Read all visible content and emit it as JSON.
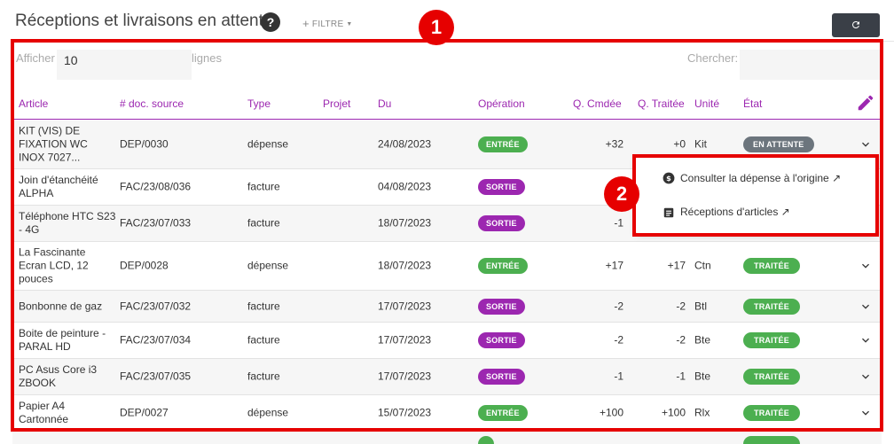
{
  "header": {
    "title": "Réceptions et livraisons en attente",
    "help": "?",
    "filter_label": "FILTRE",
    "refresh_icon": "refresh-icon"
  },
  "controls": {
    "show_label": "Afficher",
    "page_size": "10",
    "lines_label": "lignes",
    "search_label": "Chercher:"
  },
  "columns": [
    "Article",
    "# doc. source",
    "Type",
    "Projet",
    "Du",
    "Opération",
    "Q. Cmdée",
    "Q. Traitée",
    "Unité",
    "État"
  ],
  "rows": [
    {
      "article": "KIT (VIS) DE FIXATION WC INOX 7027...",
      "doc": "DEP/0030",
      "type": "dépense",
      "projet": "",
      "du": "24/08/2023",
      "operation": "ENTRÉE",
      "qcmd": "+32",
      "qtraitee": "+0",
      "unite": "Kit",
      "etat": "EN ATTENTE"
    },
    {
      "article": "Join d'étanchéité ALPHA",
      "doc": "FAC/23/08/036",
      "type": "facture",
      "projet": "",
      "du": "04/08/2023",
      "operation": "SORTIE",
      "qcmd": "",
      "qtraitee": "",
      "unite": "",
      "etat": ""
    },
    {
      "article": "Téléphone HTC S23 - 4G",
      "doc": "FAC/23/07/033",
      "type": "facture",
      "projet": "",
      "du": "18/07/2023",
      "operation": "SORTIE",
      "qcmd": "-1",
      "qtraitee": "",
      "unite": "",
      "etat": ""
    },
    {
      "article": "La Fascinante Ecran LCD, 12 pouces",
      "doc": "DEP/0028",
      "type": "dépense",
      "projet": "",
      "du": "18/07/2023",
      "operation": "ENTRÉE",
      "qcmd": "+17",
      "qtraitee": "+17",
      "unite": "Ctn",
      "etat": "TRAITÉE"
    },
    {
      "article": "Bonbonne de gaz",
      "doc": "FAC/23/07/032",
      "type": "facture",
      "projet": "",
      "du": "17/07/2023",
      "operation": "SORTIE",
      "qcmd": "-2",
      "qtraitee": "-2",
      "unite": "Btl",
      "etat": "TRAITÉE"
    },
    {
      "article": "Boite de peinture - PARAL HD",
      "doc": "FAC/23/07/034",
      "type": "facture",
      "projet": "",
      "du": "17/07/2023",
      "operation": "SORTIE",
      "qcmd": "-2",
      "qtraitee": "-2",
      "unite": "Bte",
      "etat": "TRAITÉE"
    },
    {
      "article": "PC Asus Core i3 ZBOOK",
      "doc": "FAC/23/07/035",
      "type": "facture",
      "projet": "",
      "du": "17/07/2023",
      "operation": "SORTIE",
      "qcmd": "-1",
      "qtraitee": "-1",
      "unite": "Bte",
      "etat": "TRAITÉE"
    },
    {
      "article": "Papier A4 Cartonnée",
      "doc": "DEP/0027",
      "type": "dépense",
      "projet": "",
      "du": "15/07/2023",
      "operation": "ENTRÉE",
      "qcmd": "+100",
      "qtraitee": "+100",
      "unite": "Rlx",
      "etat": "TRAITÉE"
    }
  ],
  "menu": {
    "items": [
      {
        "label": "Consulter la dépense à l'origine ↗",
        "icon": "dollar-circle-icon"
      },
      {
        "label": "Réceptions d'articles ↗",
        "icon": "document-icon"
      }
    ]
  },
  "annotations": [
    "1",
    "2"
  ],
  "colors": {
    "accent": "#9c27b0",
    "success": "#4caf50",
    "pending": "#6c757d",
    "annotation": "#e60000"
  }
}
